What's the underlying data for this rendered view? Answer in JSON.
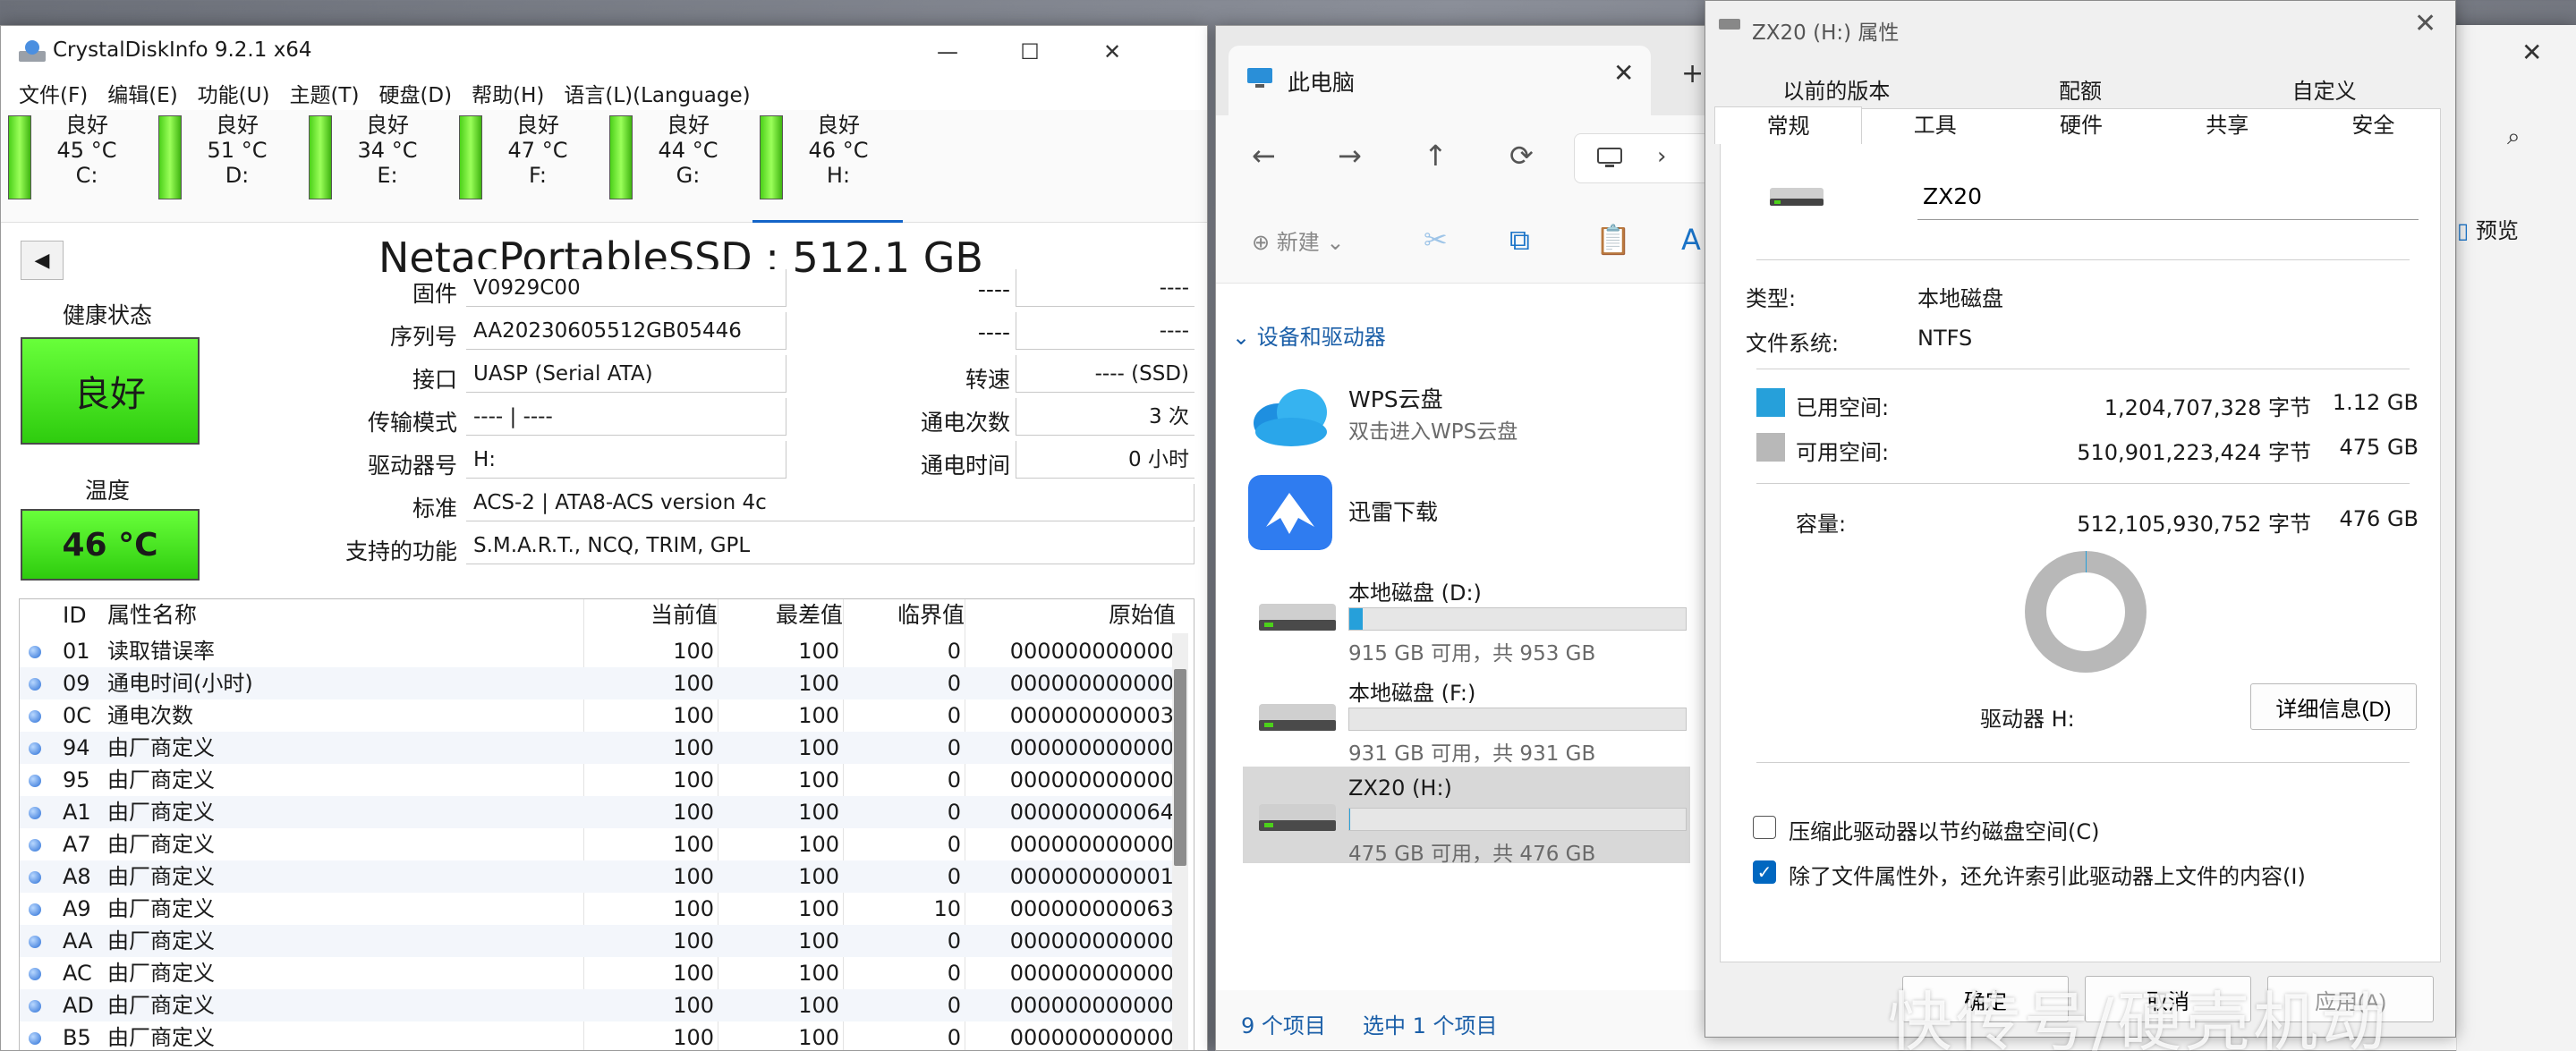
{
  "cdi": {
    "title": "CrystalDiskInfo 9.2.1 x64",
    "menu": [
      "文件(F)",
      "编辑(E)",
      "功能(U)",
      "主题(T)",
      "硬盘(D)",
      "帮助(H)",
      "语言(L)(Language)"
    ],
    "drives": [
      {
        "status": "良好",
        "temp": "45 °C",
        "letter": "C:"
      },
      {
        "status": "良好",
        "temp": "51 °C",
        "letter": "D:"
      },
      {
        "status": "良好",
        "temp": "34 °C",
        "letter": "E:"
      },
      {
        "status": "良好",
        "temp": "47 °C",
        "letter": "F:"
      },
      {
        "status": "良好",
        "temp": "44 °C",
        "letter": "G:"
      },
      {
        "status": "良好",
        "temp": "46 °C",
        "letter": "H:"
      }
    ],
    "model": "NetacPortableSSD : 512.1 GB",
    "health_label": "健康状态",
    "health_value": "良好",
    "temp_label": "温度",
    "temp_value": "46 °C",
    "info": [
      {
        "label": "固件",
        "value": "V0929C00"
      },
      {
        "label": "序列号",
        "value": "AA20230605512GB05446"
      },
      {
        "label": "接口",
        "value": "UASP (Serial ATA)"
      },
      {
        "label": "传输模式",
        "value": "---- | ----"
      },
      {
        "label": "驱动器号",
        "value": "H:"
      },
      {
        "label": "标准",
        "value": "ACS-2 | ATA8-ACS version 4c"
      },
      {
        "label": "支持的功能",
        "value": "S.M.A.R.T., NCQ, TRIM, GPL"
      }
    ],
    "info_right": [
      {
        "label": "----",
        "value": "----"
      },
      {
        "label": "----",
        "value": "----"
      },
      {
        "label": "转速",
        "value": "---- (SSD)"
      },
      {
        "label": "通电次数",
        "value": "3 次"
      },
      {
        "label": "通电时间",
        "value": "0 小时"
      }
    ],
    "table_headers": [
      "ID",
      "属性名称",
      "当前值",
      "最差值",
      "临界值",
      "原始值"
    ],
    "rows": [
      [
        "01",
        "读取错误率",
        "100",
        "100",
        "0",
        "000000000000"
      ],
      [
        "09",
        "通电时间(小时)",
        "100",
        "100",
        "0",
        "000000000000"
      ],
      [
        "0C",
        "通电次数",
        "100",
        "100",
        "0",
        "000000000003"
      ],
      [
        "94",
        "由厂商定义",
        "100",
        "100",
        "0",
        "000000000000"
      ],
      [
        "95",
        "由厂商定义",
        "100",
        "100",
        "0",
        "000000000000"
      ],
      [
        "A1",
        "由厂商定义",
        "100",
        "100",
        "0",
        "000000000064"
      ],
      [
        "A7",
        "由厂商定义",
        "100",
        "100",
        "0",
        "000000000000"
      ],
      [
        "A8",
        "由厂商定义",
        "100",
        "100",
        "0",
        "000000000001"
      ],
      [
        "A9",
        "由厂商定义",
        "100",
        "100",
        "10",
        "000000000063"
      ],
      [
        "AA",
        "由厂商定义",
        "100",
        "100",
        "0",
        "000000000000"
      ],
      [
        "AC",
        "由厂商定义",
        "100",
        "100",
        "0",
        "000000000000"
      ],
      [
        "AD",
        "由厂商定义",
        "100",
        "100",
        "0",
        "000000000000"
      ],
      [
        "B5",
        "由厂商定义",
        "100",
        "100",
        "0",
        "000000000000"
      ]
    ]
  },
  "explorer": {
    "tab_title": "此电脑",
    "new_label": "新建",
    "preview_label": "预览",
    "group_header": "设备和驱动器",
    "libs": [
      {
        "name": "WPS云盘",
        "sub": "双击进入WPS云盘"
      },
      {
        "name": "迅雷下载",
        "sub": ""
      }
    ],
    "disks": [
      {
        "name": "本地磁盘 (D:)",
        "space": "915 GB 可用，共 953 GB",
        "used_fraction": 0.04
      },
      {
        "name": "本地磁盘 (F:)",
        "space": "931 GB 可用，共 931 GB",
        "used_fraction": 0.0
      },
      {
        "name": "ZX20 (H:)",
        "space": "475 GB 可用，共 476 GB",
        "used_fraction": 0.002
      }
    ],
    "status_items": "9 个项目",
    "status_selected": "选中 1 个项目"
  },
  "props": {
    "title": "ZX20 (H:) 属性",
    "tabs_top": [
      "以前的版本",
      "配额",
      "自定义"
    ],
    "tabs_bottom": [
      "常规",
      "工具",
      "硬件",
      "共享",
      "安全"
    ],
    "name": "ZX20",
    "type_label": "类型:",
    "type_value": "本地磁盘",
    "fs_label": "文件系统:",
    "fs_value": "NTFS",
    "used_label": "已用空间:",
    "used_bytes": "1,204,707,328 字节",
    "used_size": "1.12 GB",
    "free_label": "可用空间:",
    "free_bytes": "510,901,223,424 字节",
    "free_size": "475 GB",
    "cap_label": "容量:",
    "cap_bytes": "512,105,930,752 字节",
    "cap_size": "476 GB",
    "drive_label": "驱动器 H:",
    "details_btn": "详细信息(D)",
    "compress_label": "压缩此驱动器以节约磁盘空间(C)",
    "index_label": "除了文件属性外，还允许索引此驱动器上文件的内容(I)",
    "ok": "确定",
    "cancel": "取消",
    "apply": "应用(A)",
    "used_color": "#26a0da",
    "free_color": "#b8b8b8"
  },
  "watermark": "快传号/硬壳机动"
}
